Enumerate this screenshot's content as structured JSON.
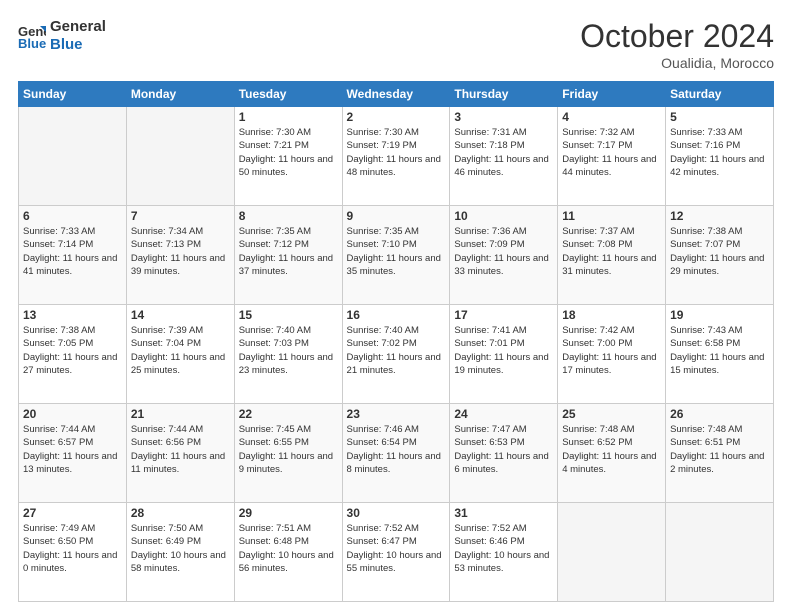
{
  "header": {
    "logo_line1": "General",
    "logo_line2": "Blue",
    "month": "October 2024",
    "location": "Oualidia, Morocco"
  },
  "days_of_week": [
    "Sunday",
    "Monday",
    "Tuesday",
    "Wednesday",
    "Thursday",
    "Friday",
    "Saturday"
  ],
  "weeks": [
    [
      {
        "day": "",
        "empty": true
      },
      {
        "day": "",
        "empty": true
      },
      {
        "day": "1",
        "sunrise": "Sunrise: 7:30 AM",
        "sunset": "Sunset: 7:21 PM",
        "daylight": "Daylight: 11 hours and 50 minutes."
      },
      {
        "day": "2",
        "sunrise": "Sunrise: 7:30 AM",
        "sunset": "Sunset: 7:19 PM",
        "daylight": "Daylight: 11 hours and 48 minutes."
      },
      {
        "day": "3",
        "sunrise": "Sunrise: 7:31 AM",
        "sunset": "Sunset: 7:18 PM",
        "daylight": "Daylight: 11 hours and 46 minutes."
      },
      {
        "day": "4",
        "sunrise": "Sunrise: 7:32 AM",
        "sunset": "Sunset: 7:17 PM",
        "daylight": "Daylight: 11 hours and 44 minutes."
      },
      {
        "day": "5",
        "sunrise": "Sunrise: 7:33 AM",
        "sunset": "Sunset: 7:16 PM",
        "daylight": "Daylight: 11 hours and 42 minutes."
      }
    ],
    [
      {
        "day": "6",
        "sunrise": "Sunrise: 7:33 AM",
        "sunset": "Sunset: 7:14 PM",
        "daylight": "Daylight: 11 hours and 41 minutes."
      },
      {
        "day": "7",
        "sunrise": "Sunrise: 7:34 AM",
        "sunset": "Sunset: 7:13 PM",
        "daylight": "Daylight: 11 hours and 39 minutes."
      },
      {
        "day": "8",
        "sunrise": "Sunrise: 7:35 AM",
        "sunset": "Sunset: 7:12 PM",
        "daylight": "Daylight: 11 hours and 37 minutes."
      },
      {
        "day": "9",
        "sunrise": "Sunrise: 7:35 AM",
        "sunset": "Sunset: 7:10 PM",
        "daylight": "Daylight: 11 hours and 35 minutes."
      },
      {
        "day": "10",
        "sunrise": "Sunrise: 7:36 AM",
        "sunset": "Sunset: 7:09 PM",
        "daylight": "Daylight: 11 hours and 33 minutes."
      },
      {
        "day": "11",
        "sunrise": "Sunrise: 7:37 AM",
        "sunset": "Sunset: 7:08 PM",
        "daylight": "Daylight: 11 hours and 31 minutes."
      },
      {
        "day": "12",
        "sunrise": "Sunrise: 7:38 AM",
        "sunset": "Sunset: 7:07 PM",
        "daylight": "Daylight: 11 hours and 29 minutes."
      }
    ],
    [
      {
        "day": "13",
        "sunrise": "Sunrise: 7:38 AM",
        "sunset": "Sunset: 7:05 PM",
        "daylight": "Daylight: 11 hours and 27 minutes."
      },
      {
        "day": "14",
        "sunrise": "Sunrise: 7:39 AM",
        "sunset": "Sunset: 7:04 PM",
        "daylight": "Daylight: 11 hours and 25 minutes."
      },
      {
        "day": "15",
        "sunrise": "Sunrise: 7:40 AM",
        "sunset": "Sunset: 7:03 PM",
        "daylight": "Daylight: 11 hours and 23 minutes."
      },
      {
        "day": "16",
        "sunrise": "Sunrise: 7:40 AM",
        "sunset": "Sunset: 7:02 PM",
        "daylight": "Daylight: 11 hours and 21 minutes."
      },
      {
        "day": "17",
        "sunrise": "Sunrise: 7:41 AM",
        "sunset": "Sunset: 7:01 PM",
        "daylight": "Daylight: 11 hours and 19 minutes."
      },
      {
        "day": "18",
        "sunrise": "Sunrise: 7:42 AM",
        "sunset": "Sunset: 7:00 PM",
        "daylight": "Daylight: 11 hours and 17 minutes."
      },
      {
        "day": "19",
        "sunrise": "Sunrise: 7:43 AM",
        "sunset": "Sunset: 6:58 PM",
        "daylight": "Daylight: 11 hours and 15 minutes."
      }
    ],
    [
      {
        "day": "20",
        "sunrise": "Sunrise: 7:44 AM",
        "sunset": "Sunset: 6:57 PM",
        "daylight": "Daylight: 11 hours and 13 minutes."
      },
      {
        "day": "21",
        "sunrise": "Sunrise: 7:44 AM",
        "sunset": "Sunset: 6:56 PM",
        "daylight": "Daylight: 11 hours and 11 minutes."
      },
      {
        "day": "22",
        "sunrise": "Sunrise: 7:45 AM",
        "sunset": "Sunset: 6:55 PM",
        "daylight": "Daylight: 11 hours and 9 minutes."
      },
      {
        "day": "23",
        "sunrise": "Sunrise: 7:46 AM",
        "sunset": "Sunset: 6:54 PM",
        "daylight": "Daylight: 11 hours and 8 minutes."
      },
      {
        "day": "24",
        "sunrise": "Sunrise: 7:47 AM",
        "sunset": "Sunset: 6:53 PM",
        "daylight": "Daylight: 11 hours and 6 minutes."
      },
      {
        "day": "25",
        "sunrise": "Sunrise: 7:48 AM",
        "sunset": "Sunset: 6:52 PM",
        "daylight": "Daylight: 11 hours and 4 minutes."
      },
      {
        "day": "26",
        "sunrise": "Sunrise: 7:48 AM",
        "sunset": "Sunset: 6:51 PM",
        "daylight": "Daylight: 11 hours and 2 minutes."
      }
    ],
    [
      {
        "day": "27",
        "sunrise": "Sunrise: 7:49 AM",
        "sunset": "Sunset: 6:50 PM",
        "daylight": "Daylight: 11 hours and 0 minutes."
      },
      {
        "day": "28",
        "sunrise": "Sunrise: 7:50 AM",
        "sunset": "Sunset: 6:49 PM",
        "daylight": "Daylight: 10 hours and 58 minutes."
      },
      {
        "day": "29",
        "sunrise": "Sunrise: 7:51 AM",
        "sunset": "Sunset: 6:48 PM",
        "daylight": "Daylight: 10 hours and 56 minutes."
      },
      {
        "day": "30",
        "sunrise": "Sunrise: 7:52 AM",
        "sunset": "Sunset: 6:47 PM",
        "daylight": "Daylight: 10 hours and 55 minutes."
      },
      {
        "day": "31",
        "sunrise": "Sunrise: 7:52 AM",
        "sunset": "Sunset: 6:46 PM",
        "daylight": "Daylight: 10 hours and 53 minutes."
      },
      {
        "day": "",
        "empty": true
      },
      {
        "day": "",
        "empty": true
      }
    ]
  ]
}
